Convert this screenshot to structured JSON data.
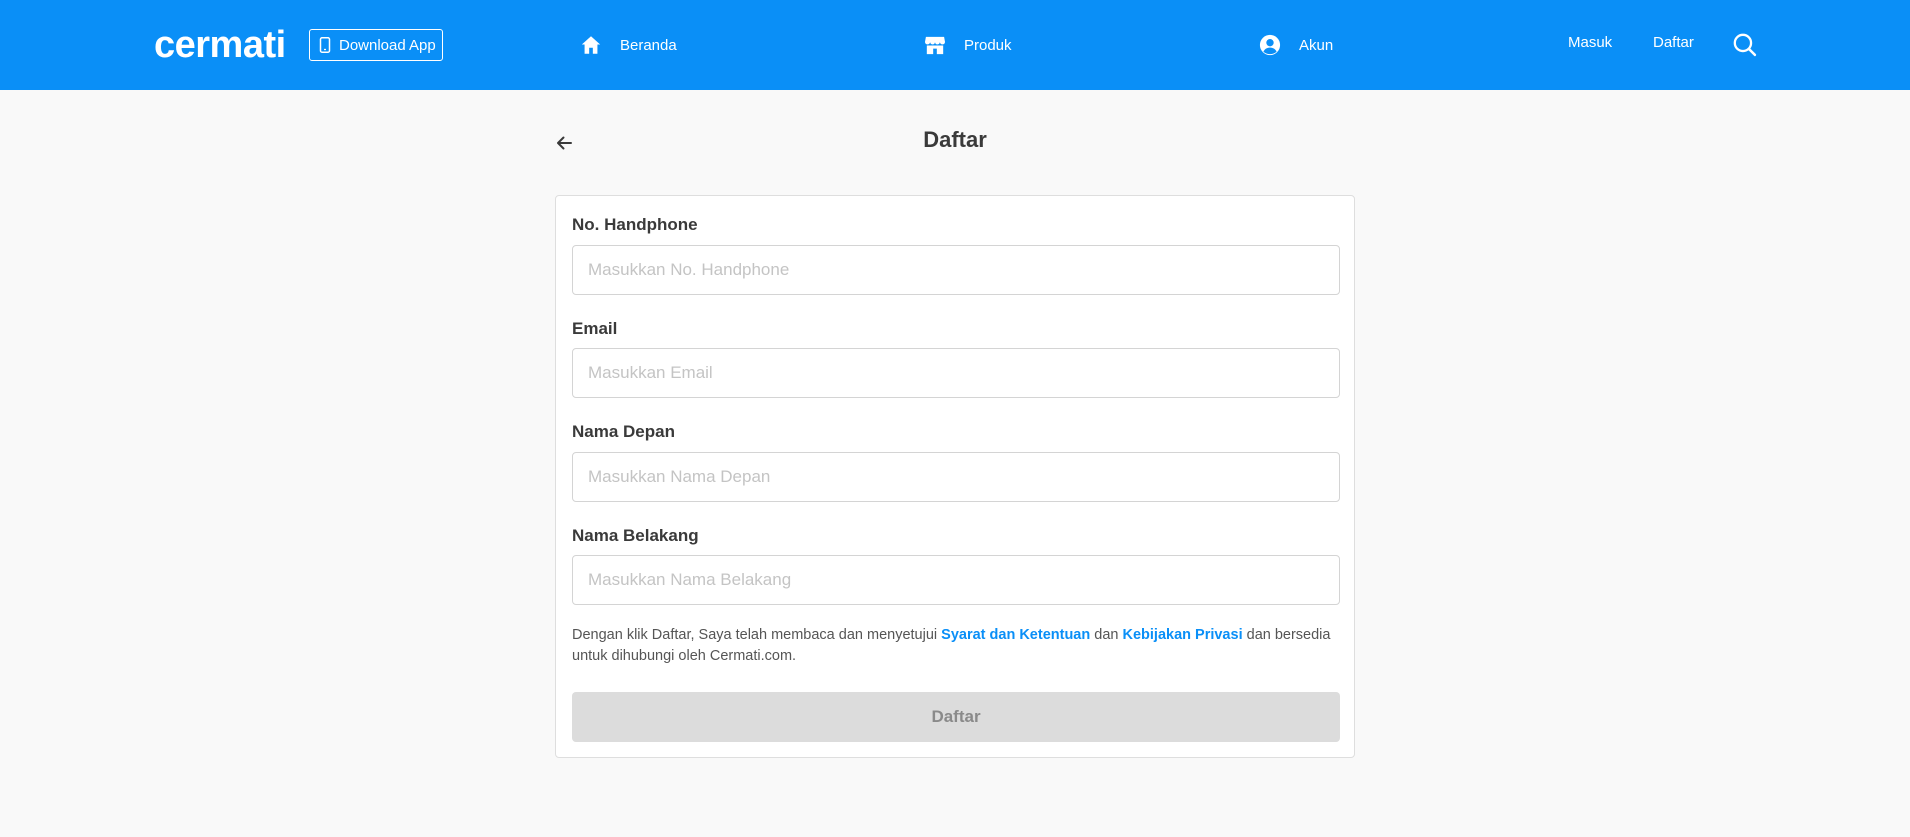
{
  "header": {
    "logo": "cermati",
    "download_label": "Download App",
    "nav": {
      "home": "Beranda",
      "produk": "Produk",
      "akun": "Akun"
    },
    "masuk": "Masuk",
    "daftar": "Daftar",
    "bg_color": "#0a8ff7"
  },
  "page": {
    "title": "Daftar"
  },
  "form": {
    "phone": {
      "label": "No. Handphone",
      "placeholder": "Masukkan No. Handphone",
      "value": ""
    },
    "email": {
      "label": "Email",
      "placeholder": "Masukkan Email",
      "value": ""
    },
    "first_name": {
      "label": "Nama Depan",
      "placeholder": "Masukkan Nama Depan",
      "value": ""
    },
    "last_name": {
      "label": "Nama Belakang",
      "placeholder": "Masukkan Nama Belakang",
      "value": ""
    },
    "terms": {
      "prefix": "Dengan klik Daftar, Saya telah membaca dan menyetujui",
      "link1": "Syarat dan Ketentuan",
      "middle": "dan",
      "link2": "Kebijakan Privasi",
      "suffix": "dan bersedia untuk dihubungi oleh Cermati.com."
    },
    "submit_label": "Daftar"
  }
}
